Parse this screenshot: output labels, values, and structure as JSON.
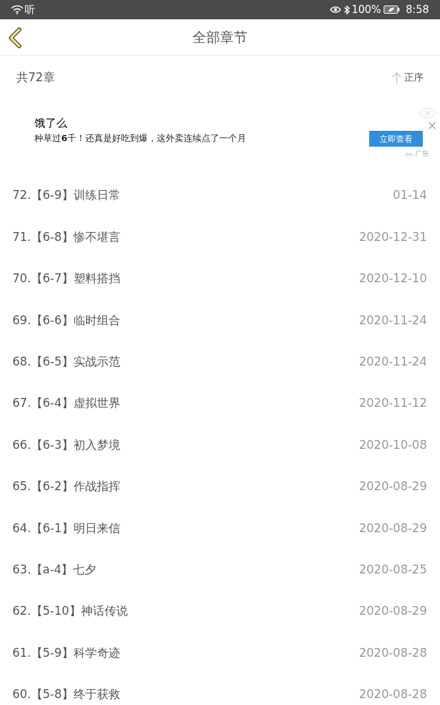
{
  "status_bar": {
    "left_text": "听",
    "battery": "100%",
    "time": "8:58"
  },
  "header": {
    "title": "全部章节"
  },
  "summary": {
    "count": "共72章",
    "sort": "正序"
  },
  "ad": {
    "title": "饿了么",
    "text": "种草过**6**千！还真是好吃到爆，这外卖连续点了一个月",
    "button": "立即查看",
    "label": "广告"
  },
  "chapters": [
    {
      "title": "72.【6-9】训练日常",
      "date": "01-14"
    },
    {
      "title": "71.【6-8】惨不堪言",
      "date": "2020-12-31"
    },
    {
      "title": "70.【6-7】塑料搭挡",
      "date": "2020-12-10"
    },
    {
      "title": "69.【6-6】临时组合",
      "date": "2020-11-24"
    },
    {
      "title": "68.【6-5】实战示范",
      "date": "2020-11-24"
    },
    {
      "title": "67.【6-4】虚拟世界",
      "date": "2020-11-12"
    },
    {
      "title": "66.【6-3】初入梦境",
      "date": "2020-10-08"
    },
    {
      "title": "65.【6-2】作战指挥",
      "date": "2020-08-29"
    },
    {
      "title": "64.【6-1】明日来信",
      "date": "2020-08-29"
    },
    {
      "title": "63.【a-4】七夕",
      "date": "2020-08-25"
    },
    {
      "title": "62.【5-10】神话传说",
      "date": "2020-08-29"
    },
    {
      "title": "61.【5-9】科学奇迹",
      "date": "2020-08-28"
    },
    {
      "title": "60.【5-8】终于获救",
      "date": "2020-08-28"
    }
  ]
}
